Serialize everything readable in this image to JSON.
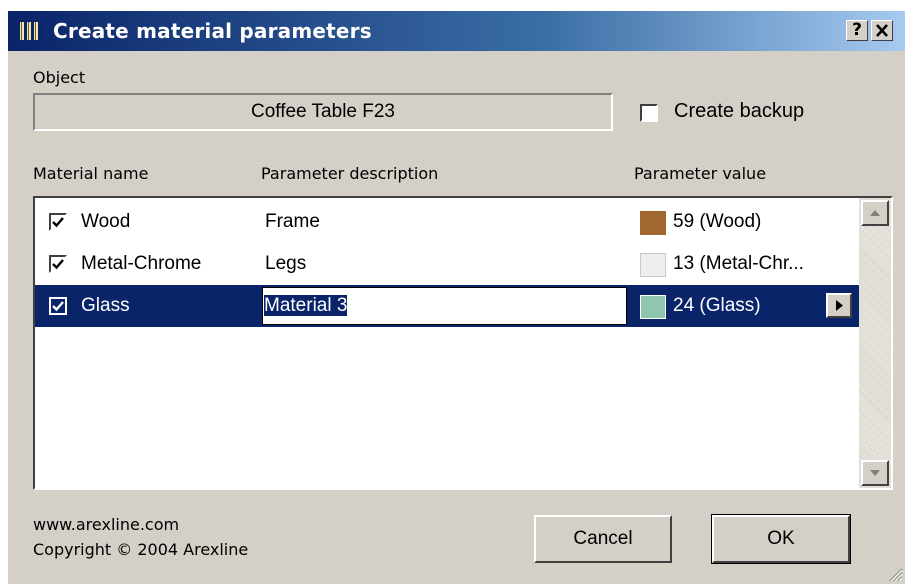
{
  "window": {
    "title": "Create material parameters",
    "help_button": "?",
    "close_button": "✕",
    "app_icon": "library-columns-icon"
  },
  "object": {
    "label": "Object",
    "value": "Coffee Table F23"
  },
  "backup": {
    "label": "Create backup",
    "checked": false
  },
  "columns": {
    "material": "Material name",
    "description": "Parameter description",
    "value": "Parameter value"
  },
  "rows": [
    {
      "checked": true,
      "material": "Wood",
      "description": "Frame",
      "value": "59 (Wood)",
      "swatch": "#a0682e",
      "selected": false
    },
    {
      "checked": true,
      "material": "Metal-Chrome",
      "description": "Legs",
      "value": "13 (Metal-Chr...",
      "swatch": "#eeeeee",
      "selected": false
    },
    {
      "checked": true,
      "material": "Glass",
      "description": "Material 3",
      "value": "24 (Glass)",
      "swatch": "#8ec6b0",
      "selected": true
    }
  ],
  "footer": {
    "url": "www.arexline.com",
    "copyright": "Copyright © 2004 Arexline"
  },
  "buttons": {
    "cancel": "Cancel",
    "ok": "OK"
  },
  "colors": {
    "selection": "#0a246a",
    "dialog_bg": "#d4d0c8"
  }
}
